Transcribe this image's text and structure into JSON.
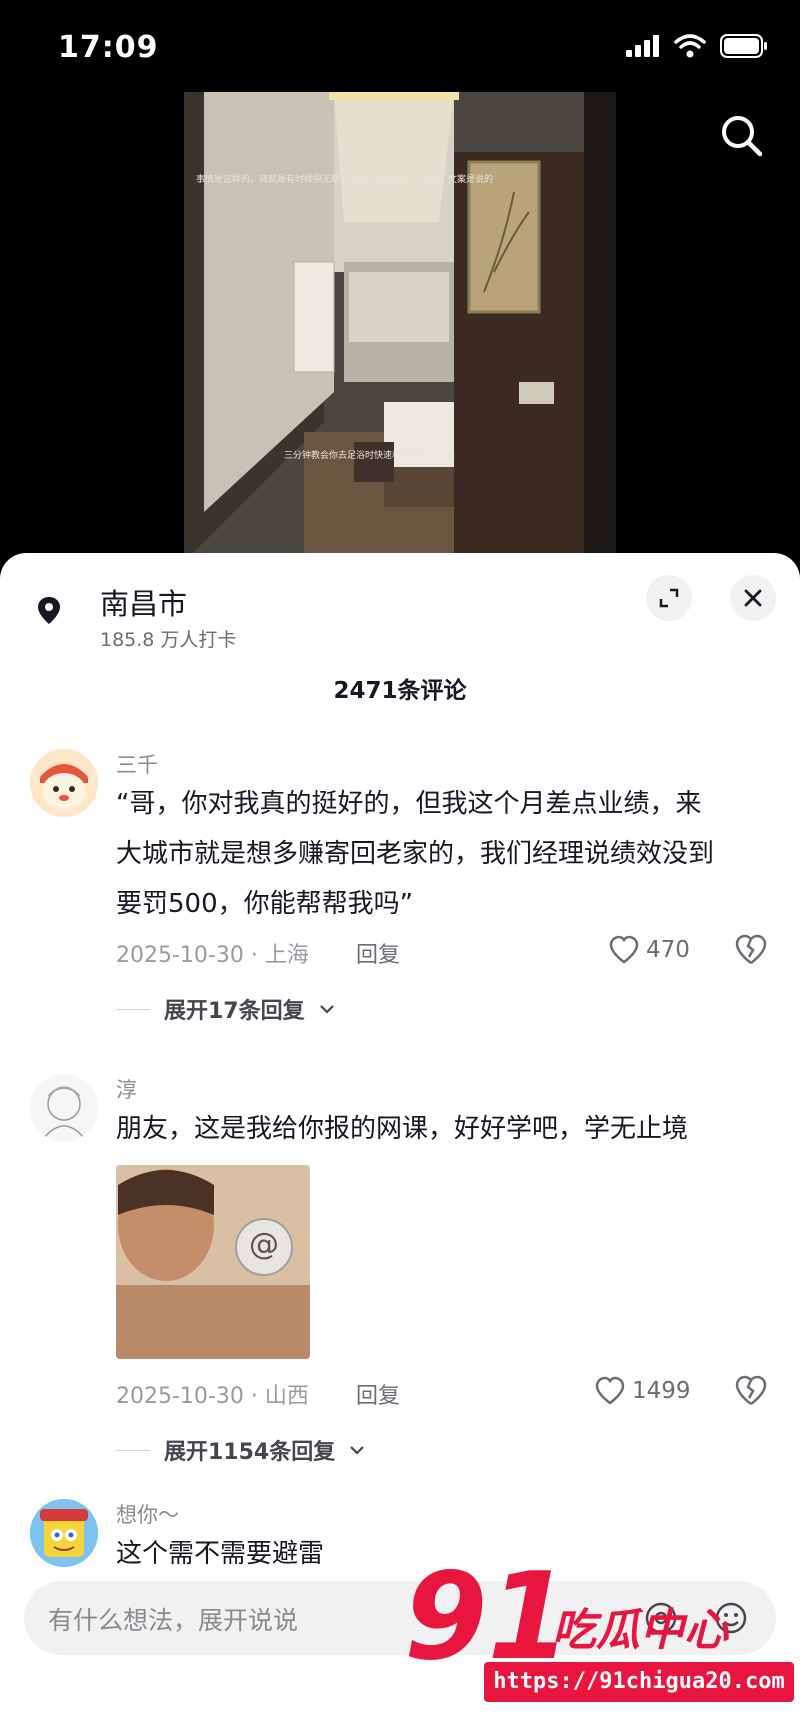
{
  "status_bar": {
    "time": "17:09"
  },
  "video": {
    "caption_top": "事情是这样的，我就是有时候很无聊，就找上去聊聊天，然后，文案是说的",
    "caption_mid": "三分钟教会你去足浴时快速和技师拉近关系"
  },
  "location": {
    "name": "南昌市",
    "checkins": "185.8 万人打卡"
  },
  "comments_header": "2471条评论",
  "comments": [
    {
      "author": "三千",
      "text_lines": [
        "“哥，你对我真的挺好的，但我这个月差点业绩，来",
        "大城市就是想多赚寄回老家的，我们经理说绩效没到",
        "要罚500，你能帮帮我吗”"
      ],
      "date_loc": "2025-10-30 · 上海",
      "reply_label": "回复",
      "likes": "470",
      "expand": "展开17条回复"
    },
    {
      "author": "淳",
      "text_lines": [
        "朋友，这是我给你报的网课，好好学吧，学无止境"
      ],
      "image_badge": "@",
      "date_loc": "2025-10-30 · 山西",
      "reply_label": "回复",
      "likes": "1499",
      "expand": "展开1154条回复"
    },
    {
      "author": "想你～",
      "text_lines": [
        "这个需不需要避雷"
      ]
    }
  ],
  "input": {
    "placeholder": "有什么想法，展开说说"
  },
  "watermark": {
    "number": "91",
    "name": "吃瓜中心",
    "url": "https://91chigua20.com"
  },
  "colors": {
    "accent": "#e8163f",
    "text": "#161823",
    "muted": "#8a8b91"
  }
}
